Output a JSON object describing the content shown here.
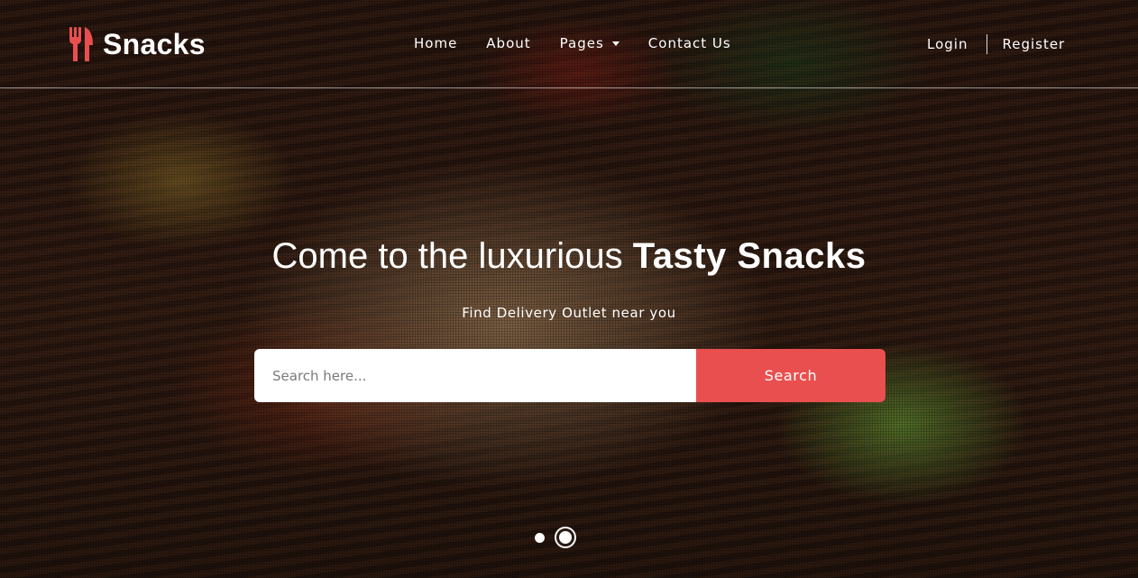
{
  "brand": {
    "name": "Snacks",
    "icon": "fork-knife-icon",
    "icon_color": "#e94f4f"
  },
  "nav": {
    "items": [
      {
        "label": "Home"
      },
      {
        "label": "About"
      },
      {
        "label": "Pages",
        "dropdown": true
      },
      {
        "label": "Contact Us"
      }
    ],
    "login_label": "Login",
    "register_label": "Register"
  },
  "hero": {
    "headline_prefix": "Come to the luxurious",
    "headline_emphasis": "Tasty Snacks",
    "subtitle": "Find Delivery Outlet near you",
    "search": {
      "placeholder": "Search here...",
      "value": "",
      "button_label": "Search"
    },
    "slides": {
      "count": 2,
      "active_index": 2
    }
  },
  "colors": {
    "accent": "#e94f4f",
    "text": "#ffffff"
  }
}
